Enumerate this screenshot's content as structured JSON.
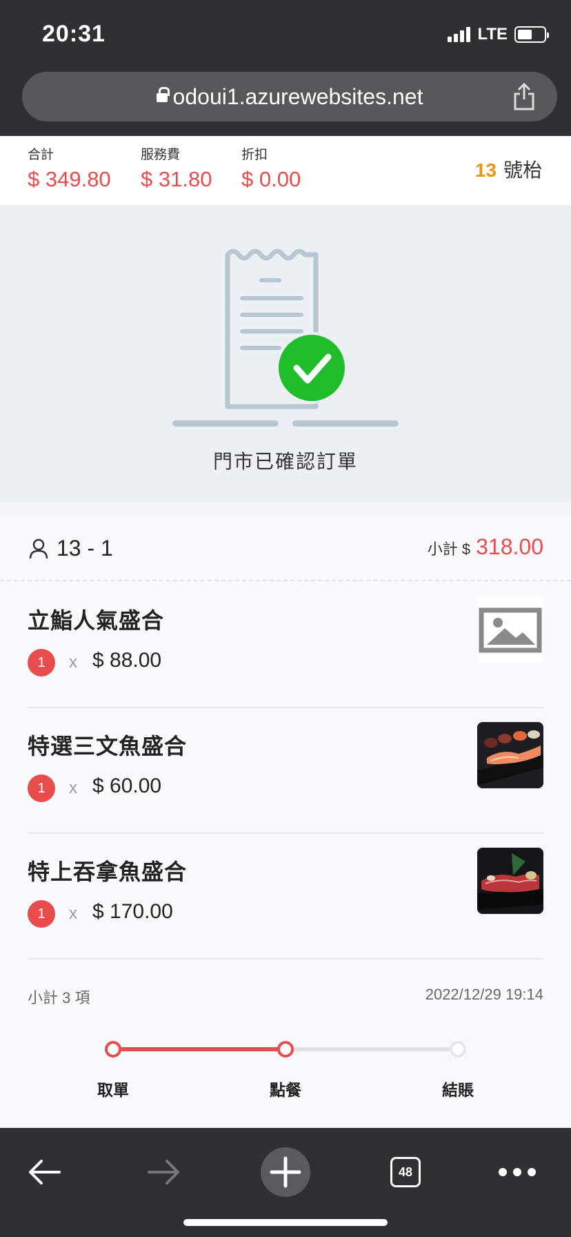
{
  "status_bar": {
    "time": "20:31",
    "network": "LTE"
  },
  "browser": {
    "url": "odoui1.azurewebsites.net",
    "tabs_count": "48"
  },
  "totals": {
    "total_label": "合計",
    "total_value": "$ 349.80",
    "service_label": "服務費",
    "service_value": "$ 31.80",
    "discount_label": "折扣",
    "discount_value": "$ 0.00",
    "table_number": "13",
    "table_suffix": "號枱"
  },
  "order_status": {
    "text": "門市已確認訂單"
  },
  "order": {
    "guest": "13 - 1",
    "subtotal_label": "小計 $",
    "subtotal_value": "318.00",
    "items": [
      {
        "name": "立鮨人氣盛合",
        "qty": "1",
        "times": "x",
        "price": "$ 88.00",
        "image": "placeholder-image-icon"
      },
      {
        "name": "特選三文魚盛合",
        "qty": "1",
        "times": "x",
        "price": "$ 60.00",
        "image": "salmon-sushi-photo"
      },
      {
        "name": "特上吞拿魚盛合",
        "qty": "1",
        "times": "x",
        "price": "$ 170.00",
        "image": "tuna-sushi-photo"
      }
    ],
    "summary_count": "小計 3 項",
    "timestamp": "2022/12/29 19:14"
  },
  "progress": {
    "current_step": 2,
    "steps": [
      "取單",
      "點餐",
      "結賬"
    ]
  },
  "colors": {
    "accent": "#e84c4c",
    "table_number": "#e8961a",
    "confirm_green": "#1fbd2a",
    "receipt": "#b8c6d1"
  }
}
